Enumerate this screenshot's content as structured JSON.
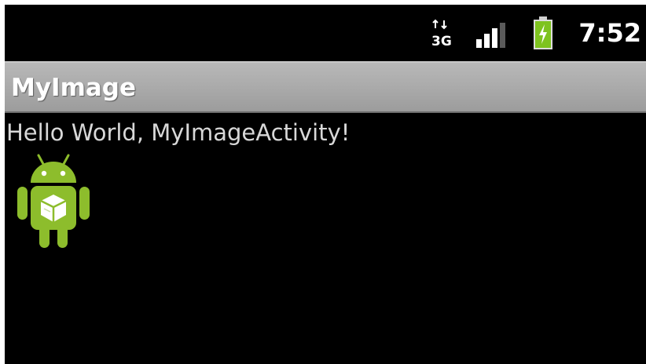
{
  "status_bar": {
    "network_icon": "network-3g-icon",
    "network_label": "3G",
    "signal_icon": "signal-strength-icon",
    "battery_icon": "battery-charging-icon",
    "time": "7:52"
  },
  "title_bar": {
    "title": "MyImage"
  },
  "content": {
    "text": "Hello World, MyImageActivity!",
    "image_icon": "android-robot-icon"
  },
  "colors": {
    "background": "#000000",
    "title_bar": "#a9a9a9",
    "title_text": "#ffffff",
    "body_text": "#d8d8d8",
    "android_green": "#8dbd2c",
    "battery_green": "#7ec31f"
  }
}
